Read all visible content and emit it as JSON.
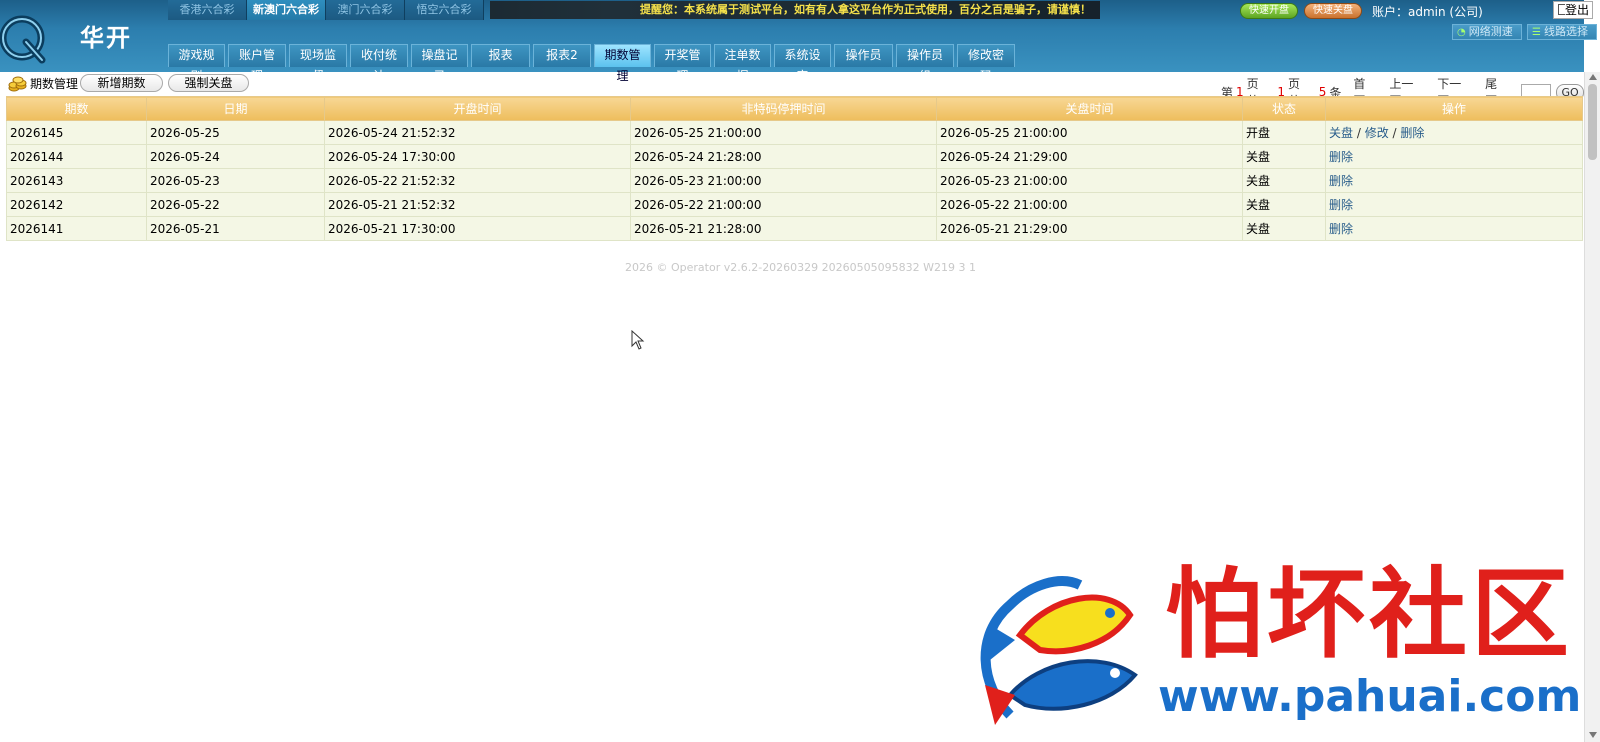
{
  "header": {
    "brand": "华开",
    "lottery_tabs": [
      {
        "label": "香港六合彩",
        "active": false
      },
      {
        "label": "新澳门六合彩",
        "active": true
      },
      {
        "label": "澳门六合彩",
        "active": false
      },
      {
        "label": "悟空六合彩",
        "active": false
      }
    ],
    "notice": "提醒您：本系统属于测试平台，如有有人拿这平台作为正式使用，百分之百是骗子，请谨慎！",
    "quick_open": "快速开盘",
    "quick_close": "快速关盘",
    "account": "账户：admin (公司)",
    "logout": "登出",
    "net_test": "网络测速",
    "line_select": "线路选择",
    "nav": [
      {
        "label": "游戏规则",
        "active": false
      },
      {
        "label": "账户管理",
        "active": false
      },
      {
        "label": "现场监督",
        "active": false
      },
      {
        "label": "收付统计",
        "active": false
      },
      {
        "label": "操盘记录",
        "active": false
      },
      {
        "label": "报表",
        "active": false
      },
      {
        "label": "报表2",
        "active": false
      },
      {
        "label": "期数管理",
        "active": true
      },
      {
        "label": "开奖管理",
        "active": false
      },
      {
        "label": "注单数据",
        "active": false
      },
      {
        "label": "系统设定",
        "active": false
      },
      {
        "label": "操作员",
        "active": false
      },
      {
        "label": "操作员组",
        "active": false
      },
      {
        "label": "修改密码",
        "active": false
      }
    ]
  },
  "toolbar": {
    "title": "期数管理",
    "add_label": "新增期数",
    "force_close_label": "强制关盘"
  },
  "pager": {
    "p1": "第",
    "current": "1",
    "p2": "页 共",
    "total_pages": "1",
    "p3": "页 共",
    "total_items": "5",
    "p4": "条",
    "first": "首页",
    "prev": "上一页",
    "next": "下一页",
    "last": "尾页",
    "go": "GO"
  },
  "table": {
    "headers": [
      "期数",
      "日期",
      "开盘时间",
      "非特码停押时间",
      "关盘时间",
      "状态",
      "操作"
    ],
    "rows": [
      {
        "period": "2026145",
        "date": "2026-05-25",
        "open": "2026-05-24 21:52:32",
        "stop": "2026-05-25 21:00:00",
        "close": "2026-05-25 21:00:00",
        "status": "开盘",
        "actions": [
          "关盘",
          "修改",
          "删除"
        ]
      },
      {
        "period": "2026144",
        "date": "2026-05-24",
        "open": "2026-05-24 17:30:00",
        "stop": "2026-05-24 21:28:00",
        "close": "2026-05-24 21:29:00",
        "status": "关盘",
        "actions": [
          "删除"
        ]
      },
      {
        "period": "2026143",
        "date": "2026-05-23",
        "open": "2026-05-22 21:52:32",
        "stop": "2026-05-23 21:00:00",
        "close": "2026-05-23 21:00:00",
        "status": "关盘",
        "actions": [
          "删除"
        ]
      },
      {
        "period": "2026142",
        "date": "2026-05-22",
        "open": "2026-05-21 21:52:32",
        "stop": "2026-05-22 21:00:00",
        "close": "2026-05-22 21:00:00",
        "status": "关盘",
        "actions": [
          "删除"
        ]
      },
      {
        "period": "2026141",
        "date": "2026-05-21",
        "open": "2026-05-21 17:30:00",
        "stop": "2026-05-21 21:28:00",
        "close": "2026-05-21 21:29:00",
        "status": "关盘",
        "actions": [
          "删除"
        ]
      }
    ]
  },
  "footer": "2026 ©       Operator v2.6.2-20260329 20260505095832 W219 3 1",
  "watermark": {
    "cn": "怕坏社区",
    "url": "www.pahuai.com"
  }
}
